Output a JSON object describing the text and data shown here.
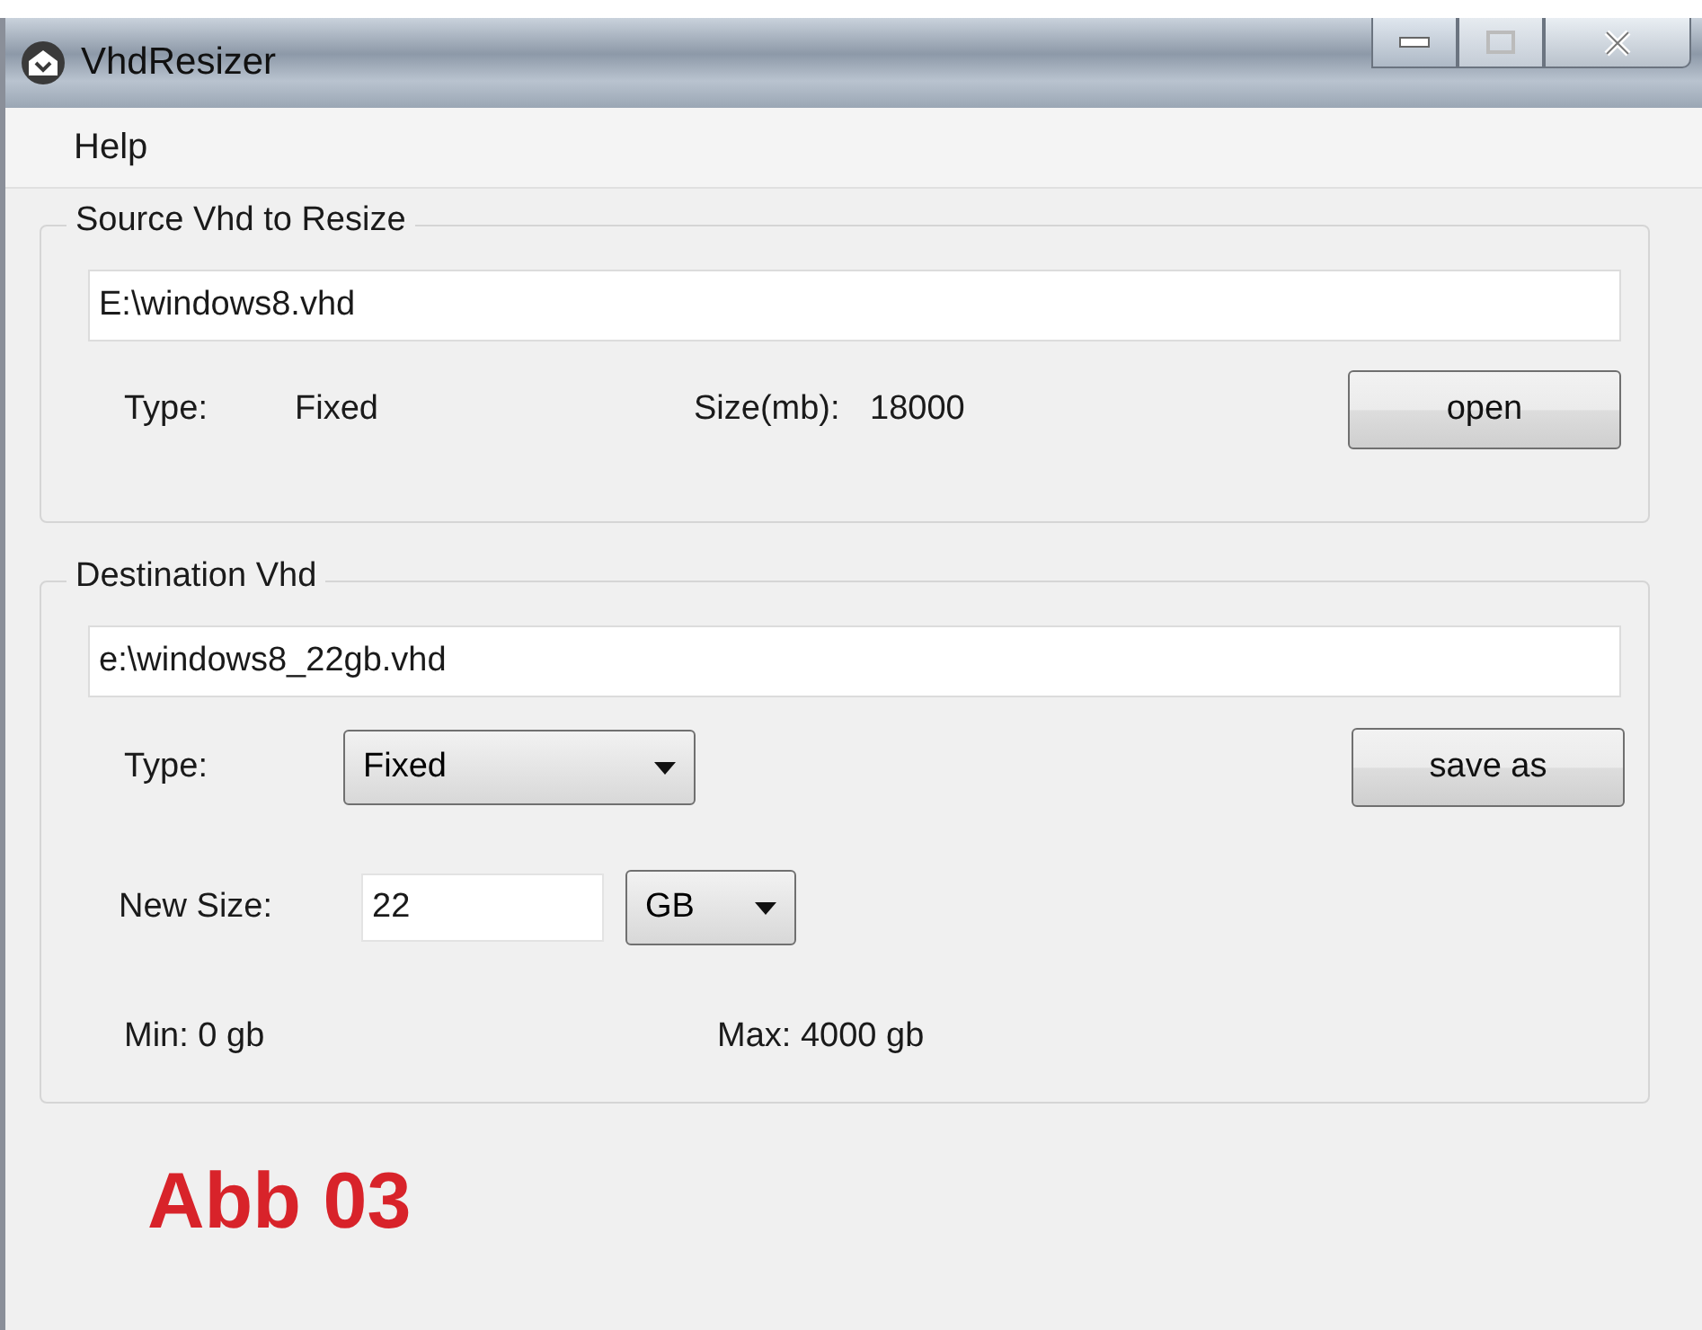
{
  "window": {
    "title": "VhdResizer"
  },
  "menu": [
    {
      "label": "Help"
    }
  ],
  "source": {
    "legend": "Source Vhd to Resize",
    "path": "E:\\windows8.vhd",
    "type_label": "Type:",
    "type_value": "Fixed",
    "size_label": "Size(mb):",
    "size_value": "18000",
    "button": "open"
  },
  "destination": {
    "legend": "Destination Vhd",
    "path": "e:\\windows8_22gb.vhd",
    "type_label": "Type:",
    "type_select": "Fixed",
    "button": "save as",
    "new_size_label": "New Size:",
    "new_size": "22",
    "unit_select": "GB",
    "min": "Min: 0 gb",
    "max": "Max: 4000 gb"
  },
  "caption": "Abb 03"
}
